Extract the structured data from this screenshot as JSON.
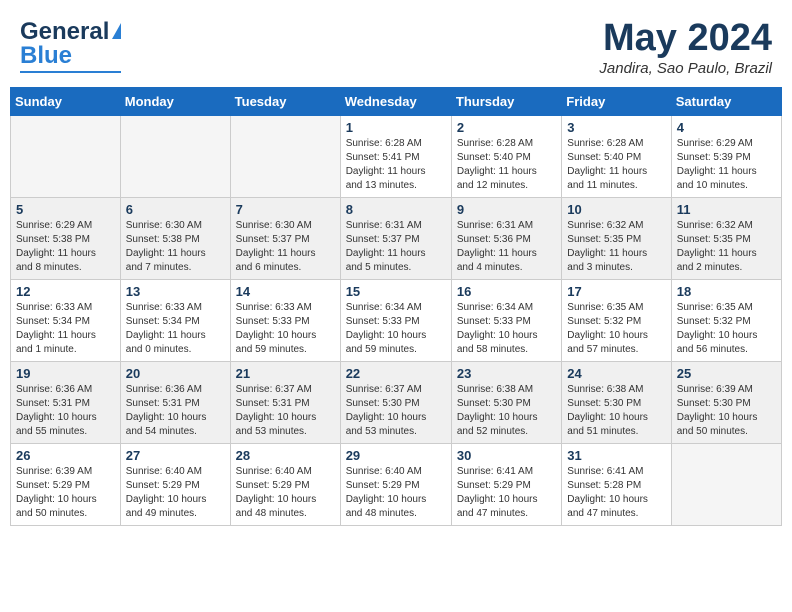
{
  "header": {
    "logo_line1": "General",
    "logo_line2": "Blue",
    "month": "May 2024",
    "location": "Jandira, Sao Paulo, Brazil"
  },
  "days_of_week": [
    "Sunday",
    "Monday",
    "Tuesday",
    "Wednesday",
    "Thursday",
    "Friday",
    "Saturday"
  ],
  "weeks": [
    {
      "shaded": false,
      "days": [
        {
          "num": "",
          "info": ""
        },
        {
          "num": "",
          "info": ""
        },
        {
          "num": "",
          "info": ""
        },
        {
          "num": "1",
          "info": "Sunrise: 6:28 AM\nSunset: 5:41 PM\nDaylight: 11 hours\nand 13 minutes."
        },
        {
          "num": "2",
          "info": "Sunrise: 6:28 AM\nSunset: 5:40 PM\nDaylight: 11 hours\nand 12 minutes."
        },
        {
          "num": "3",
          "info": "Sunrise: 6:28 AM\nSunset: 5:40 PM\nDaylight: 11 hours\nand 11 minutes."
        },
        {
          "num": "4",
          "info": "Sunrise: 6:29 AM\nSunset: 5:39 PM\nDaylight: 11 hours\nand 10 minutes."
        }
      ]
    },
    {
      "shaded": true,
      "days": [
        {
          "num": "5",
          "info": "Sunrise: 6:29 AM\nSunset: 5:38 PM\nDaylight: 11 hours\nand 8 minutes."
        },
        {
          "num": "6",
          "info": "Sunrise: 6:30 AM\nSunset: 5:38 PM\nDaylight: 11 hours\nand 7 minutes."
        },
        {
          "num": "7",
          "info": "Sunrise: 6:30 AM\nSunset: 5:37 PM\nDaylight: 11 hours\nand 6 minutes."
        },
        {
          "num": "8",
          "info": "Sunrise: 6:31 AM\nSunset: 5:37 PM\nDaylight: 11 hours\nand 5 minutes."
        },
        {
          "num": "9",
          "info": "Sunrise: 6:31 AM\nSunset: 5:36 PM\nDaylight: 11 hours\nand 4 minutes."
        },
        {
          "num": "10",
          "info": "Sunrise: 6:32 AM\nSunset: 5:35 PM\nDaylight: 11 hours\nand 3 minutes."
        },
        {
          "num": "11",
          "info": "Sunrise: 6:32 AM\nSunset: 5:35 PM\nDaylight: 11 hours\nand 2 minutes."
        }
      ]
    },
    {
      "shaded": false,
      "days": [
        {
          "num": "12",
          "info": "Sunrise: 6:33 AM\nSunset: 5:34 PM\nDaylight: 11 hours\nand 1 minute."
        },
        {
          "num": "13",
          "info": "Sunrise: 6:33 AM\nSunset: 5:34 PM\nDaylight: 11 hours\nand 0 minutes."
        },
        {
          "num": "14",
          "info": "Sunrise: 6:33 AM\nSunset: 5:33 PM\nDaylight: 10 hours\nand 59 minutes."
        },
        {
          "num": "15",
          "info": "Sunrise: 6:34 AM\nSunset: 5:33 PM\nDaylight: 10 hours\nand 59 minutes."
        },
        {
          "num": "16",
          "info": "Sunrise: 6:34 AM\nSunset: 5:33 PM\nDaylight: 10 hours\nand 58 minutes."
        },
        {
          "num": "17",
          "info": "Sunrise: 6:35 AM\nSunset: 5:32 PM\nDaylight: 10 hours\nand 57 minutes."
        },
        {
          "num": "18",
          "info": "Sunrise: 6:35 AM\nSunset: 5:32 PM\nDaylight: 10 hours\nand 56 minutes."
        }
      ]
    },
    {
      "shaded": true,
      "days": [
        {
          "num": "19",
          "info": "Sunrise: 6:36 AM\nSunset: 5:31 PM\nDaylight: 10 hours\nand 55 minutes."
        },
        {
          "num": "20",
          "info": "Sunrise: 6:36 AM\nSunset: 5:31 PM\nDaylight: 10 hours\nand 54 minutes."
        },
        {
          "num": "21",
          "info": "Sunrise: 6:37 AM\nSunset: 5:31 PM\nDaylight: 10 hours\nand 53 minutes."
        },
        {
          "num": "22",
          "info": "Sunrise: 6:37 AM\nSunset: 5:30 PM\nDaylight: 10 hours\nand 53 minutes."
        },
        {
          "num": "23",
          "info": "Sunrise: 6:38 AM\nSunset: 5:30 PM\nDaylight: 10 hours\nand 52 minutes."
        },
        {
          "num": "24",
          "info": "Sunrise: 6:38 AM\nSunset: 5:30 PM\nDaylight: 10 hours\nand 51 minutes."
        },
        {
          "num": "25",
          "info": "Sunrise: 6:39 AM\nSunset: 5:30 PM\nDaylight: 10 hours\nand 50 minutes."
        }
      ]
    },
    {
      "shaded": false,
      "days": [
        {
          "num": "26",
          "info": "Sunrise: 6:39 AM\nSunset: 5:29 PM\nDaylight: 10 hours\nand 50 minutes."
        },
        {
          "num": "27",
          "info": "Sunrise: 6:40 AM\nSunset: 5:29 PM\nDaylight: 10 hours\nand 49 minutes."
        },
        {
          "num": "28",
          "info": "Sunrise: 6:40 AM\nSunset: 5:29 PM\nDaylight: 10 hours\nand 48 minutes."
        },
        {
          "num": "29",
          "info": "Sunrise: 6:40 AM\nSunset: 5:29 PM\nDaylight: 10 hours\nand 48 minutes."
        },
        {
          "num": "30",
          "info": "Sunrise: 6:41 AM\nSunset: 5:29 PM\nDaylight: 10 hours\nand 47 minutes."
        },
        {
          "num": "31",
          "info": "Sunrise: 6:41 AM\nSunset: 5:28 PM\nDaylight: 10 hours\nand 47 minutes."
        },
        {
          "num": "",
          "info": ""
        }
      ]
    }
  ]
}
